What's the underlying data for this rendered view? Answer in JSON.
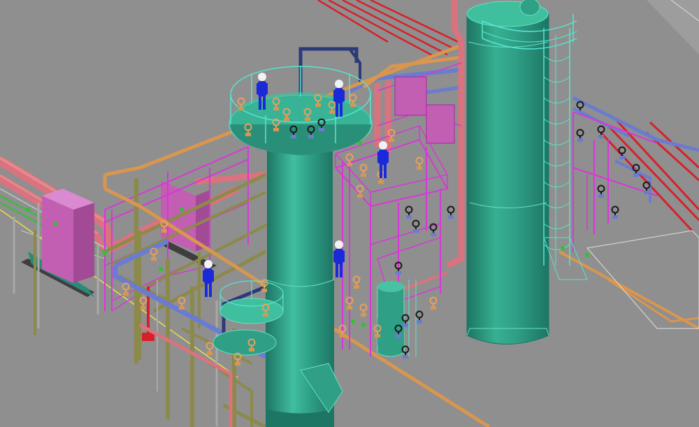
{
  "scene": {
    "colors": {
      "background": "#8f8f8f",
      "tower_body": "#2f9f86",
      "tower_light": "#49c2a3",
      "tower_dark": "#1d7563",
      "tower_rim": "#64e0c2",
      "steel_magenta": "#d936d9",
      "steel_magenta_dark": "#a424a4",
      "pipe_pink": "#d9737f",
      "pipe_pink_dark": "#a84a58",
      "pipe_salmon": "#e58a8a",
      "pipe_orange": "#d9964f",
      "pipe_blue": "#6a7ccf",
      "pipe_navy": "#2d3a78",
      "pipe_olive": "#8c8a4a",
      "pipe_olive_light": "#b0ad63",
      "pipe_red": "#d8202a",
      "pipe_yellow": "#e8e04a",
      "pipe_green": "#30c230",
      "ladder_cyan": "#55e6d0",
      "foundation_pink": "#c35fb2",
      "foundation_dark": "#3e3e3e",
      "worker_blue": "#1a2ad8",
      "worker_helmet": "#f2f2f2",
      "valve_orange": "#e8a060",
      "valve_black": "#1a1a1a",
      "white_line": "#e8e8e8"
    },
    "icons": {
      "worker": "person-hardhat-icon",
      "valve": "valve-handwheel-icon"
    }
  }
}
